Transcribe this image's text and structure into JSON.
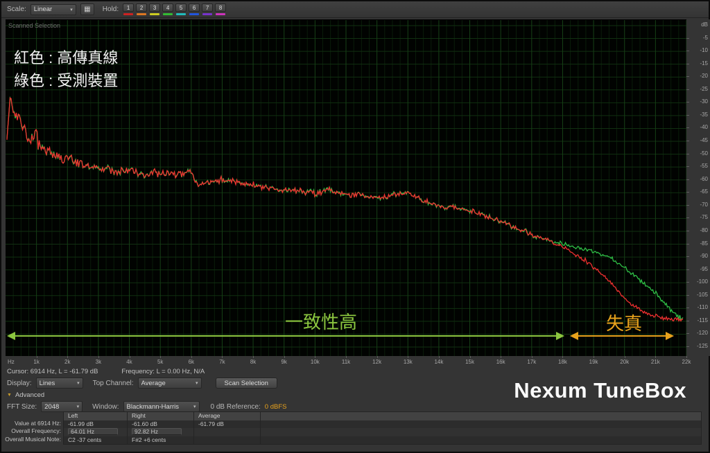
{
  "icons": {
    "dropdown_arrow": "▾",
    "disclosure_triangle": "▼",
    "hold_panel": "▦"
  },
  "toolbar": {
    "scale_label": "Scale:",
    "scale_value": "Linear",
    "hold_label": "Hold:",
    "hold_buttons": [
      {
        "label": "1",
        "color": "#cc2222"
      },
      {
        "label": "2",
        "color": "#dd7722"
      },
      {
        "label": "3",
        "color": "#cccc22"
      },
      {
        "label": "4",
        "color": "#33bb33"
      },
      {
        "label": "5",
        "color": "#22bbbb"
      },
      {
        "label": "6",
        "color": "#2255dd"
      },
      {
        "label": "7",
        "color": "#7733cc"
      },
      {
        "label": "8",
        "color": "#cc33bb"
      }
    ]
  },
  "plot": {
    "scanned_selection_label": "Scanned Selection",
    "legend_red_text": "紅色 : 高傳真線",
    "legend_green_text": "綠色 : 受測裝置",
    "annotation_consistency": "一致性高",
    "annotation_distortion": "失真",
    "annotation_green_color": "#8cc63f",
    "annotation_orange_color": "#e8a21c",
    "db_axis_label": "dB",
    "db_tick_step": 5,
    "db_min": -125,
    "freq_ticks": [
      "Hz",
      "1k",
      "2k",
      "3k",
      "4k",
      "5k",
      "6k",
      "7k",
      "8k",
      "9k",
      "10k",
      "11k",
      "12k",
      "13k",
      "14k",
      "15k",
      "16k",
      "17k",
      "18k",
      "19k",
      "20k",
      "21k",
      "22k"
    ]
  },
  "chart_data": {
    "type": "line",
    "title": "Frequency Analysis (FFT spectrum)",
    "xlabel": "Hz",
    "ylabel": "dB",
    "x_range_hz": [
      0,
      22000
    ],
    "y_range_db": [
      -125,
      0
    ],
    "grid": true,
    "legend_position": "top-left",
    "series": [
      {
        "name": "紅色 : 高傳真線",
        "color": "#f03030",
        "points": [
          [
            30,
            -45
          ],
          [
            100,
            -33
          ],
          [
            150,
            -29
          ],
          [
            200,
            -32
          ],
          [
            300,
            -34
          ],
          [
            400,
            -36
          ],
          [
            500,
            -38
          ],
          [
            650,
            -41
          ],
          [
            800,
            -44
          ],
          [
            950,
            -42
          ],
          [
            1100,
            -46
          ],
          [
            1300,
            -48
          ],
          [
            1500,
            -50
          ],
          [
            1800,
            -52
          ],
          [
            2100,
            -51
          ],
          [
            2400,
            -54
          ],
          [
            2700,
            -55
          ],
          [
            3000,
            -56
          ],
          [
            3300,
            -55
          ],
          [
            3600,
            -57
          ],
          [
            4000,
            -56
          ],
          [
            4400,
            -58
          ],
          [
            4800,
            -57
          ],
          [
            5200,
            -58
          ],
          [
            5600,
            -58
          ],
          [
            6000,
            -57
          ],
          [
            6200,
            -62
          ],
          [
            6600,
            -61
          ],
          [
            7000,
            -60
          ],
          [
            7500,
            -61
          ],
          [
            8000,
            -62
          ],
          [
            8500,
            -63
          ],
          [
            9000,
            -64
          ],
          [
            9500,
            -64
          ],
          [
            10000,
            -65
          ],
          [
            10500,
            -64
          ],
          [
            11000,
            -66
          ],
          [
            11500,
            -66
          ],
          [
            12000,
            -67
          ],
          [
            12500,
            -66
          ],
          [
            13000,
            -65
          ],
          [
            13500,
            -68
          ],
          [
            14000,
            -70
          ],
          [
            14500,
            -71
          ],
          [
            15000,
            -72
          ],
          [
            15500,
            -74
          ],
          [
            16000,
            -76
          ],
          [
            16500,
            -79
          ],
          [
            17000,
            -81
          ],
          [
            17500,
            -83
          ],
          [
            18000,
            -86
          ],
          [
            18300,
            -88
          ],
          [
            18700,
            -91
          ],
          [
            19000,
            -94
          ],
          [
            19300,
            -97
          ],
          [
            19700,
            -102
          ],
          [
            20000,
            -106
          ],
          [
            20300,
            -109
          ],
          [
            20700,
            -112
          ],
          [
            21000,
            -113
          ],
          [
            21500,
            -114
          ],
          [
            22000,
            -115
          ]
        ]
      },
      {
        "name": "綠色 : 受測裝置",
        "color": "#2fbf46",
        "points": [
          [
            30,
            -45
          ],
          [
            100,
            -33
          ],
          [
            150,
            -29
          ],
          [
            200,
            -32
          ],
          [
            300,
            -34
          ],
          [
            400,
            -36
          ],
          [
            500,
            -38
          ],
          [
            650,
            -41
          ],
          [
            800,
            -44
          ],
          [
            950,
            -42
          ],
          [
            1100,
            -46
          ],
          [
            1300,
            -48
          ],
          [
            1500,
            -50
          ],
          [
            1800,
            -52
          ],
          [
            2100,
            -51
          ],
          [
            2400,
            -54
          ],
          [
            2700,
            -55
          ],
          [
            3000,
            -56
          ],
          [
            3300,
            -55
          ],
          [
            3600,
            -57
          ],
          [
            4000,
            -56
          ],
          [
            4400,
            -58
          ],
          [
            4800,
            -57
          ],
          [
            5200,
            -58
          ],
          [
            5600,
            -58
          ],
          [
            6000,
            -57
          ],
          [
            6200,
            -62
          ],
          [
            6600,
            -61
          ],
          [
            7000,
            -60
          ],
          [
            7500,
            -61
          ],
          [
            8000,
            -62
          ],
          [
            8500,
            -63
          ],
          [
            9000,
            -64
          ],
          [
            9500,
            -64
          ],
          [
            10000,
            -65
          ],
          [
            10500,
            -64
          ],
          [
            11000,
            -66
          ],
          [
            11500,
            -66
          ],
          [
            12000,
            -67
          ],
          [
            12500,
            -66
          ],
          [
            13000,
            -65
          ],
          [
            13500,
            -68
          ],
          [
            14000,
            -70
          ],
          [
            14500,
            -71
          ],
          [
            15000,
            -72
          ],
          [
            15500,
            -74
          ],
          [
            16000,
            -76
          ],
          [
            16500,
            -79
          ],
          [
            17000,
            -81
          ],
          [
            17500,
            -83
          ],
          [
            18000,
            -85
          ],
          [
            18500,
            -86
          ],
          [
            19000,
            -88
          ],
          [
            19500,
            -90
          ],
          [
            20000,
            -94
          ],
          [
            20500,
            -99
          ],
          [
            21000,
            -104
          ],
          [
            21400,
            -109
          ],
          [
            21700,
            -113
          ],
          [
            22000,
            -115
          ]
        ]
      }
    ]
  },
  "status": {
    "cursor_text": "Cursor: 6914 Hz, L = -61.79 dB",
    "frequency_text": "Frequency: L = 0.00 Hz, N/A"
  },
  "controls": {
    "display_label": "Display:",
    "display_value": "Lines",
    "top_channel_label": "Top Channel:",
    "top_channel_value": "Average",
    "scan_selection_label": "Scan Selection"
  },
  "advanced": {
    "section_label": "Advanced",
    "fft_size_label": "FFT Size:",
    "fft_size_value": "2048",
    "window_label": "Window:",
    "window_value": "Blackmann-Harris",
    "reference_label": "0 dB Reference:",
    "reference_value": "0 dBFS"
  },
  "table": {
    "headers": {
      "left": "Left",
      "right": "Right",
      "average": "Average"
    },
    "rows": [
      {
        "label": "Value at 6914 Hz:",
        "left": "-61.99 dB",
        "right": "-61.60 dB",
        "average": "-61.79 dB"
      },
      {
        "label": "Overall Frequency:",
        "left": "64.01 Hz",
        "right": "92.82 Hz",
        "average": ""
      },
      {
        "label": "Overall Musical Note:",
        "left": "C2 -37 cents",
        "right": "F#2 +6 cents",
        "average": ""
      }
    ]
  },
  "watermark": "Nexum TuneBox"
}
